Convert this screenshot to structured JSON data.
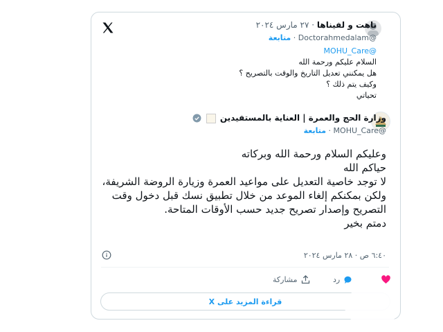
{
  "quoted": {
    "name": "ناهت و لفيناها",
    "date": "٢٧ مارس ٢٠٢٤",
    "handle": "@Doctorahmedalam",
    "follow": "متابعة",
    "mention": "@MOHU_Care",
    "lines": [
      "السلام عليكم ورحمة الله",
      "هل يمكنني تعديل التاريخ والوقت بالتصريح ؟",
      "وكيف يتم ذلك ؟",
      "تحياتي"
    ]
  },
  "reply": {
    "name": "وزارة الحج والعمرة | العناية بالمستفيدين",
    "handle": "@MOHU_Care",
    "follow": "متابعة",
    "lines": [
      "وعليكم السلام ورحمة الله وبركاته",
      "حياكم الله",
      "لا توجد خاصية التعديل على مواعيد العمرة وزيارة الروضة الشريفة، ولكن بمكنكم إلغاء الموعد من خلال تطبيق نسك قبل دخول وقت التصريح وإصدار تصريح جديد حسب الأوقات المتاحة.",
      "دمتم بخير"
    ],
    "timestamp": "٦:٤٠ ص · ٢٨ مارس ٢٠٢٤"
  },
  "actions": {
    "reply_label": "رد",
    "share_label": "مشاركة"
  },
  "readmore_label": "قراءة المزيد على X",
  "colors": {
    "accent": "#1d9bf0",
    "like": "#f91880",
    "muted": "#536471"
  },
  "icons": [
    "x-logo-icon",
    "verified-icon",
    "info-icon",
    "heart-icon",
    "comment-icon",
    "share-icon"
  ]
}
